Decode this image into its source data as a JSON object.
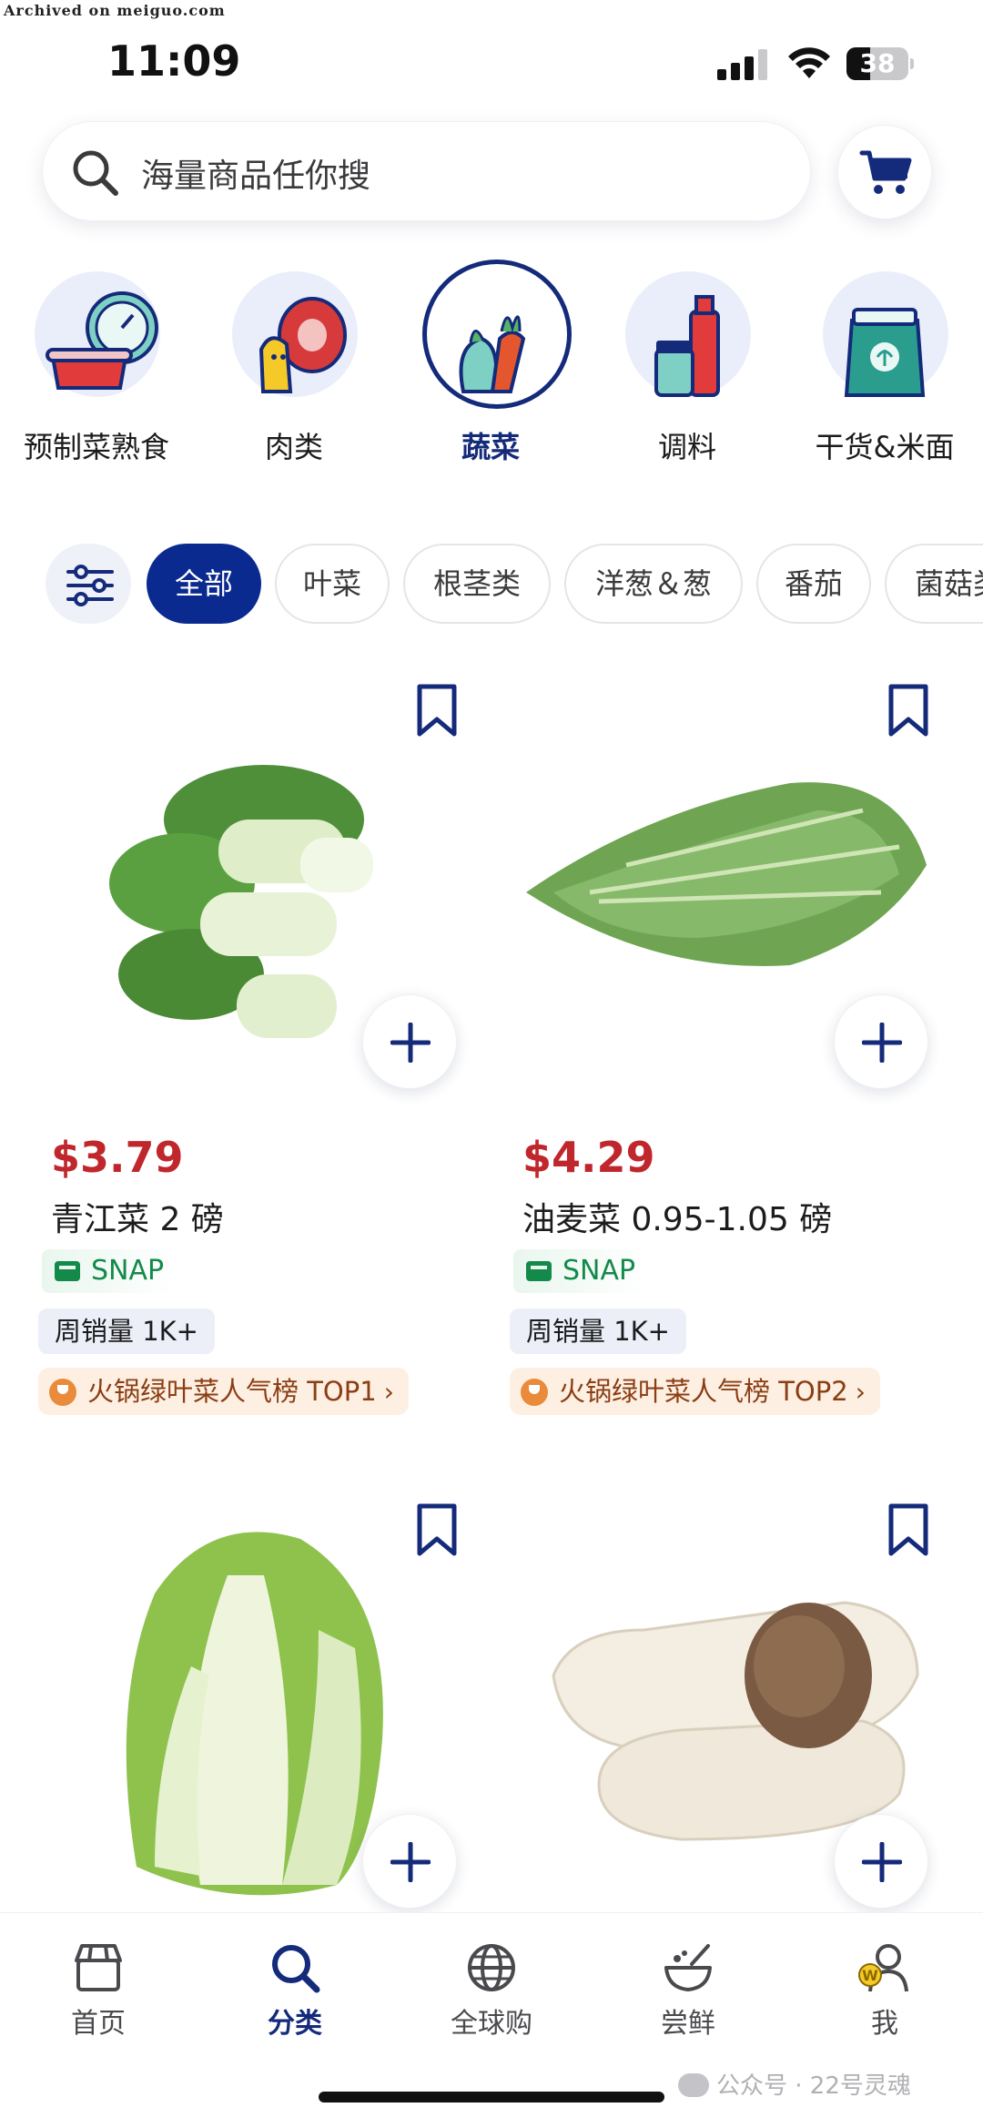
{
  "archive_note": "Archived on meiguo.com",
  "status": {
    "time": "11:09",
    "battery": "38",
    "battery_level": 0.38
  },
  "search": {
    "placeholder": "海量商品任你搜"
  },
  "categories": [
    {
      "label": "预制菜熟食",
      "icon": "prepared-food-icon"
    },
    {
      "label": "肉类",
      "icon": "meat-icon"
    },
    {
      "label": "蔬菜",
      "icon": "vegetable-icon",
      "active": true
    },
    {
      "label": "调料",
      "icon": "seasoning-icon"
    },
    {
      "label": "干货&米面",
      "icon": "dry-goods-icon"
    }
  ],
  "filters": [
    "全部",
    "叶菜",
    "根茎类",
    "洋葱＆葱",
    "番茄",
    "菌菇类"
  ],
  "products": [
    {
      "price": "$3.79",
      "name": "青江菜 2 磅",
      "snap": "SNAP",
      "weekly": "周销量 1K+",
      "rank": "火锅绿叶菜人气榜 TOP1"
    },
    {
      "price": "$4.29",
      "name": "油麦菜 0.95-1.05 磅",
      "snap": "SNAP",
      "weekly": "周销量 1K+",
      "rank": "火锅绿叶菜人气榜 TOP2"
    },
    {
      "image": "napa-cabbage"
    },
    {
      "image": "king-oyster-mushroom"
    }
  ],
  "nav": [
    {
      "label": "首页",
      "icon": "store-icon"
    },
    {
      "label": "分类",
      "icon": "search-icon",
      "active": true
    },
    {
      "label": "全球购",
      "icon": "globe-icon"
    },
    {
      "label": "尝鲜",
      "icon": "bowl-icon"
    },
    {
      "label": "我",
      "icon": "user-icon"
    }
  ],
  "watermark": "公众号 · 22号灵魂",
  "colors": {
    "accent": "#0b2a8f",
    "price": "#c0272d",
    "snap": "#138a4a"
  }
}
